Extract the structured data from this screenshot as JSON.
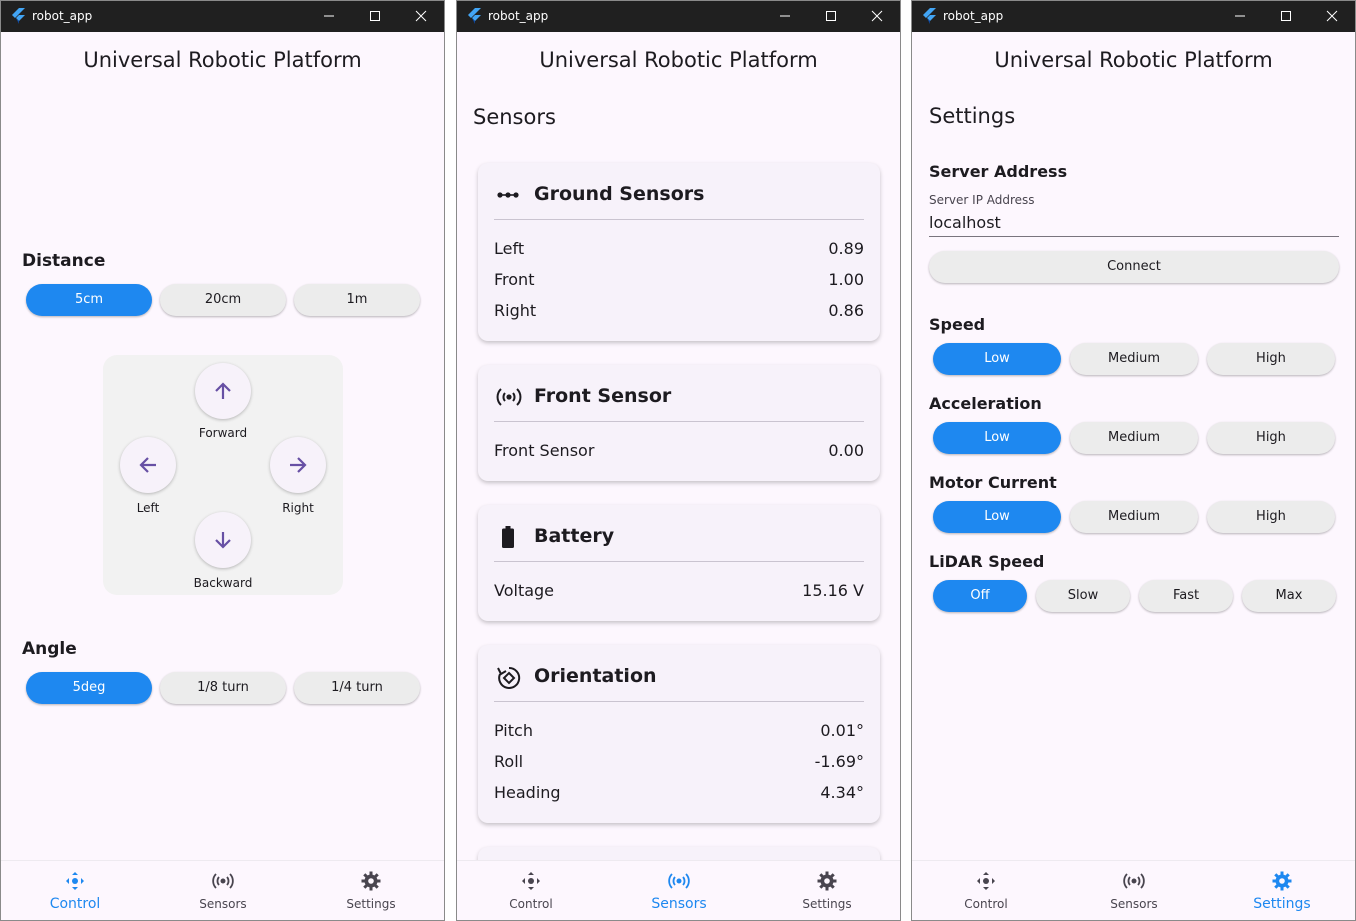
{
  "window_title": "robot_app",
  "app_title": "Universal Robotic Platform",
  "colors": {
    "accent": "#1e88f0",
    "purple_icon": "#6750a4",
    "surface": "#fdf7fe"
  },
  "control": {
    "distance_label": "Distance",
    "distance_options": [
      "5cm",
      "20cm",
      "1m"
    ],
    "distance_selected": "5cm",
    "pad": {
      "forward": "Forward",
      "left": "Left",
      "right": "Right",
      "backward": "Backward"
    },
    "angle_label": "Angle",
    "angle_options": [
      "5deg",
      "1/8 turn",
      "1/4 turn"
    ],
    "angle_selected": "5deg"
  },
  "sensors": {
    "heading": "Sensors",
    "cards": [
      {
        "icon": "dots-line-icon",
        "title": "Ground Sensors",
        "rows": [
          {
            "k": "Left",
            "v": "0.89"
          },
          {
            "k": "Front",
            "v": "1.00"
          },
          {
            "k": "Right",
            "v": "0.86"
          }
        ]
      },
      {
        "icon": "sensors-icon",
        "title": "Front Sensor",
        "rows": [
          {
            "k": "Front Sensor",
            "v": "0.00"
          }
        ]
      },
      {
        "icon": "battery-icon",
        "title": "Battery",
        "rows": [
          {
            "k": "Voltage",
            "v": "15.16 V"
          }
        ]
      },
      {
        "icon": "rotate-icon",
        "title": "Orientation",
        "rows": [
          {
            "k": "Pitch",
            "v": "0.01°"
          },
          {
            "k": "Roll",
            "v": "-1.69°"
          },
          {
            "k": "Heading",
            "v": "4.34°"
          }
        ]
      }
    ]
  },
  "settings": {
    "heading": "Settings",
    "server_section": "Server Address",
    "server_field_label": "Server IP Address",
    "server_field_value": "localhost",
    "connect_label": "Connect",
    "speed_label": "Speed",
    "speed_options": [
      "Low",
      "Medium",
      "High"
    ],
    "acceleration_label": "Acceleration",
    "acceleration_options": [
      "Low",
      "Medium",
      "High"
    ],
    "motor_label": "Motor Current",
    "motor_options": [
      "Low",
      "Medium",
      "High"
    ],
    "lidar_label": "LiDAR Speed",
    "lidar_options": [
      "Off",
      "Slow",
      "Fast",
      "Max"
    ]
  },
  "nav": {
    "control": "Control",
    "sensors": "Sensors",
    "settings": "Settings"
  }
}
